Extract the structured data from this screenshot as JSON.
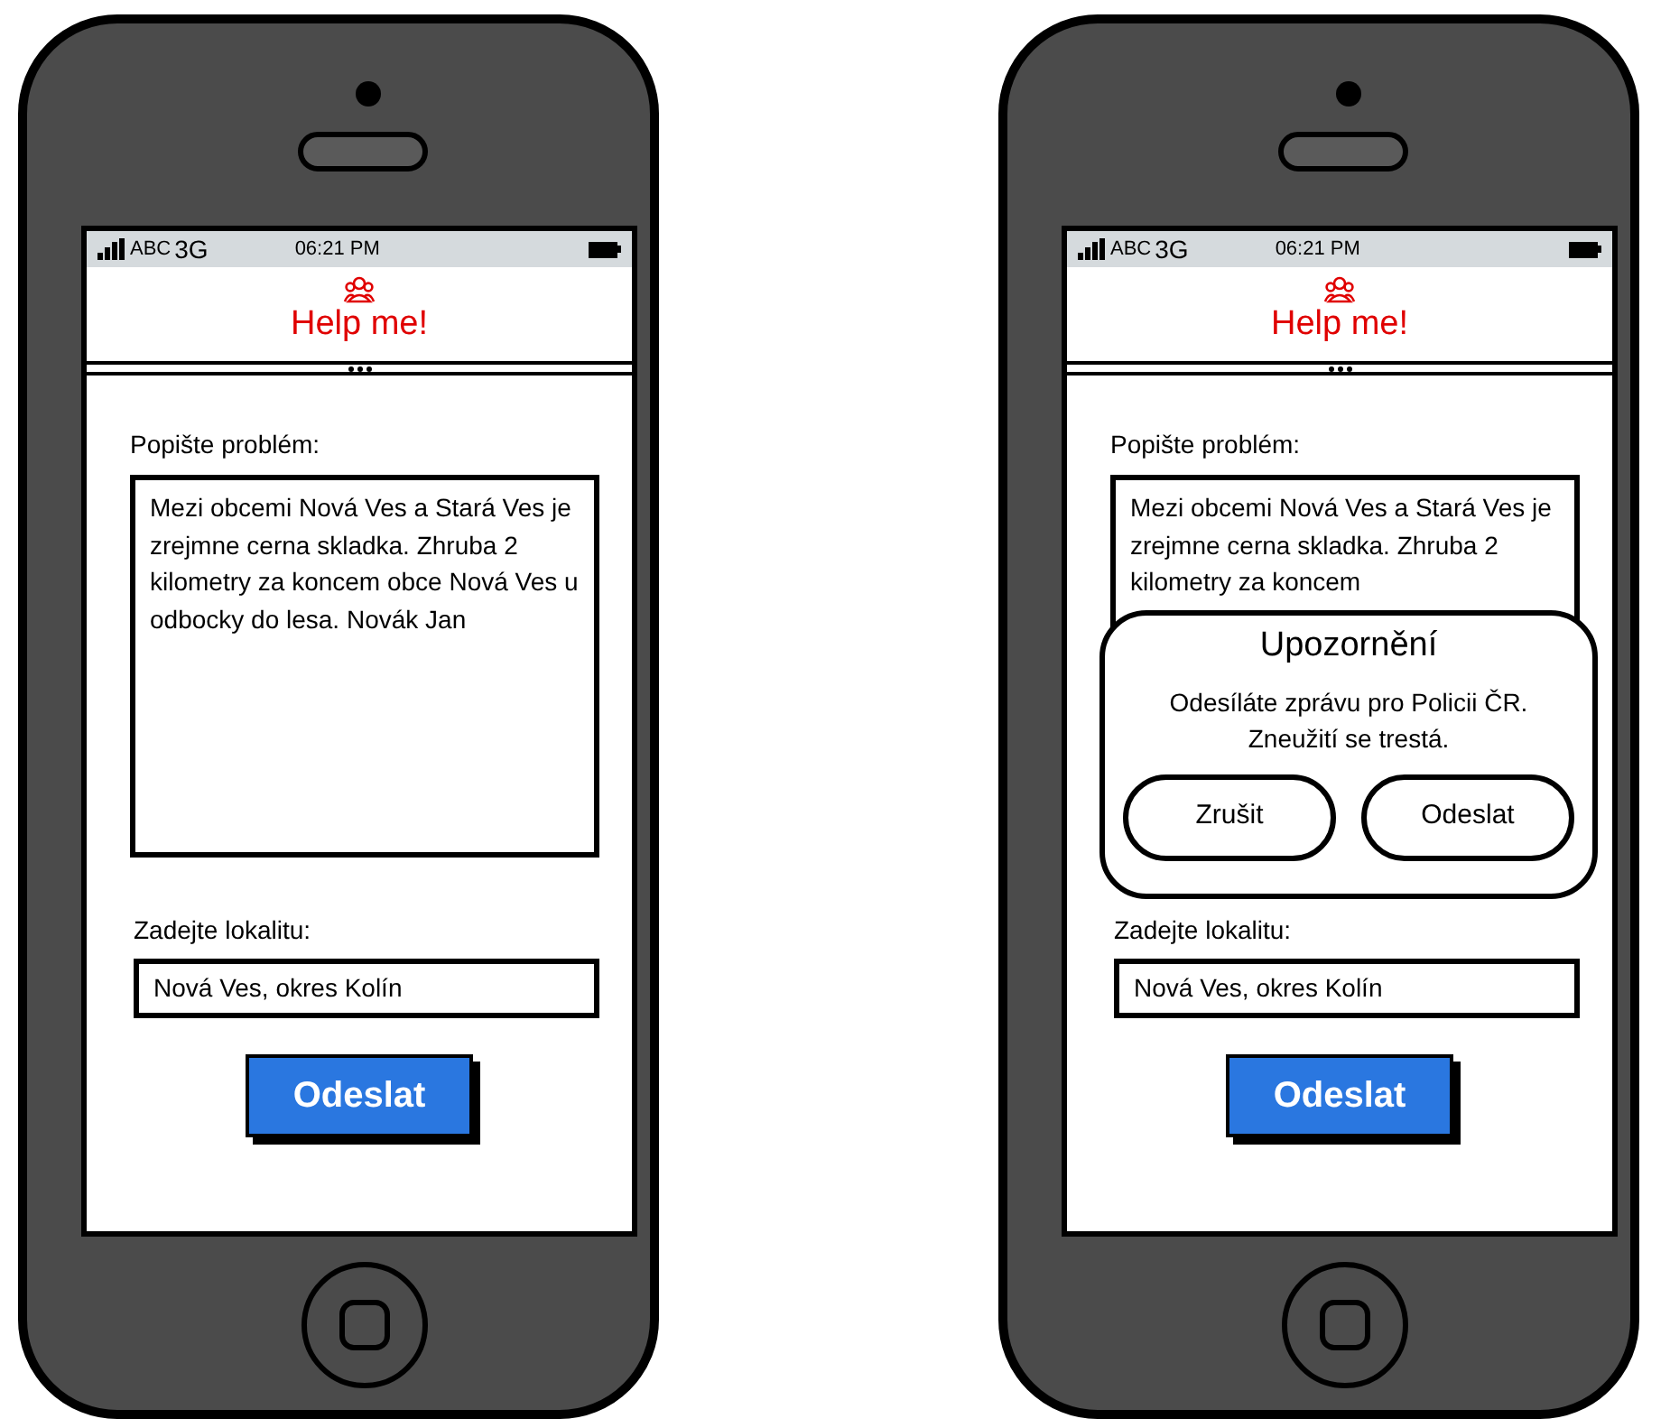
{
  "phones": [
    {
      "status_bar": {
        "carrier": "ABC",
        "network": "3G",
        "time": "06:21 PM"
      },
      "header": {
        "title": "Help me!"
      },
      "form": {
        "description_label": "Popište problém:",
        "description_value": "Mezi obcemi Nová Ves a Stará Ves je zrejmne cerna skladka. Zhruba 2 kilometry za koncem obce Nová Ves u odbocky do lesa. Novák Jan",
        "location_label": "Zadejte lokalitu:",
        "location_value": "Nová Ves, okres Kolín",
        "submit": "Odeslat"
      }
    },
    {
      "status_bar": {
        "carrier": "ABC",
        "network": "3G",
        "time": "06:21 PM"
      },
      "header": {
        "title": "Help me!"
      },
      "form": {
        "description_label": "Popište problém:",
        "description_value": "Mezi obcemi Nová Ves a Stará Ves je zrejmne cerna skladka. Zhruba 2 kilometry za koncem",
        "location_label": "Zadejte lokalitu:",
        "location_value": "Nová Ves, okres Kolín",
        "submit": "Odeslat"
      },
      "dialog": {
        "title": "Upozornění",
        "message": "Odesíláte zprávu pro Policii ČR. Zneužití se trestá.",
        "buttons": [
          "Zrušit",
          "Odeslat"
        ]
      }
    }
  ]
}
